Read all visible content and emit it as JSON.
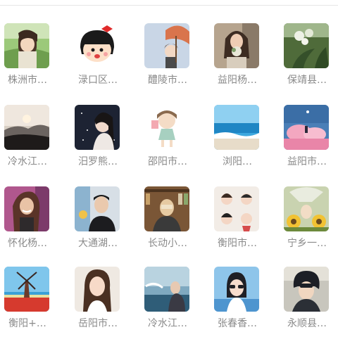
{
  "contacts": [
    {
      "name": "株洲市…",
      "avatar": "anime-boy-avatar"
    },
    {
      "name": "渌口区…",
      "avatar": "cartoon-girl-avatar"
    },
    {
      "name": "醴陵市…",
      "avatar": "girl-umbrella-avatar"
    },
    {
      "name": "益阳杨…",
      "avatar": "woman-flowers-avatar"
    },
    {
      "name": "保靖县…",
      "avatar": "white-flowers-avatar"
    },
    {
      "name": "冷水江…",
      "avatar": "sunset-hills-avatar"
    },
    {
      "name": "汨罗熊…",
      "avatar": "night-girl-avatar"
    },
    {
      "name": "邵阳市…",
      "avatar": "chibi-girl-avatar"
    },
    {
      "name": "浏阳…",
      "avatar": "ocean-beach-avatar"
    },
    {
      "name": "益阳市…",
      "avatar": "pink-cloud-avatar"
    },
    {
      "name": "怀化杨…",
      "avatar": "smiling-woman-avatar"
    },
    {
      "name": "大通湖…",
      "avatar": "young-man-avatar"
    },
    {
      "name": "长动小…",
      "avatar": "bookshelf-girl-avatar"
    },
    {
      "name": "衡阳市…",
      "avatar": "couple-sketch-avatar"
    },
    {
      "name": "宁乡一…",
      "avatar": "sunflower-avatar"
    },
    {
      "name": "衡阳+…",
      "avatar": "windmill-tulips-avatar"
    },
    {
      "name": "岳阳市…",
      "avatar": "long-hair-girl-avatar"
    },
    {
      "name": "冷水江…",
      "avatar": "seaside-woman-avatar"
    },
    {
      "name": "张春香…",
      "avatar": "woman-sunglasses-avatar"
    },
    {
      "name": "永顺县…",
      "avatar": "anime-young-man-avatar"
    }
  ]
}
